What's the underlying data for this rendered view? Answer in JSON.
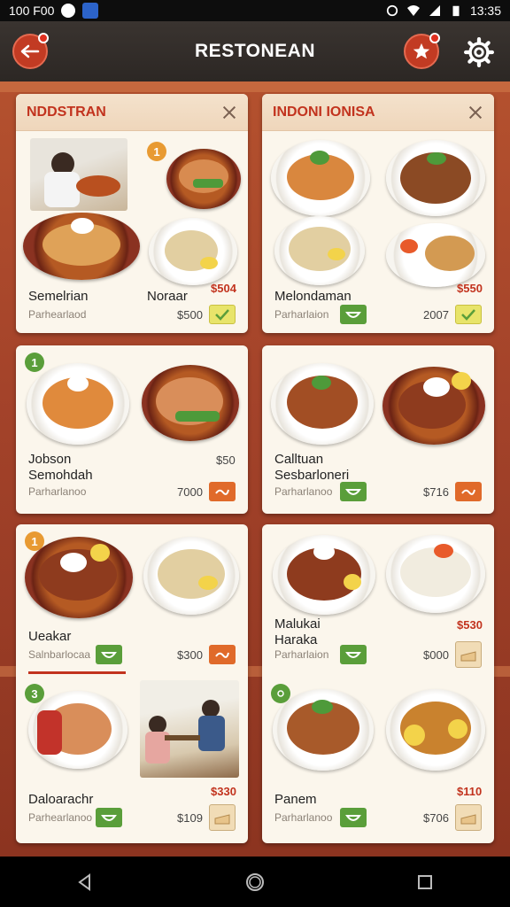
{
  "status_bar": {
    "left_text": "100 F00",
    "time": "13:35"
  },
  "app_bar": {
    "title": "RESTONEAN"
  },
  "cards": [
    {
      "title": "NDDSTRAN",
      "badge_top": "1",
      "items": [
        {
          "name": "Semelrian",
          "subtitle": "Parhearlaod",
          "price": "$500",
          "price_red": "$504"
        },
        {
          "name": "Noraar"
        }
      ]
    },
    {
      "title": "INDONI IONISA",
      "items": [
        {
          "name": "Melondaman",
          "subtitle": "Parharlaion",
          "price": "2007",
          "price_red": "$550"
        }
      ]
    },
    {
      "badge_top": "1",
      "items": [
        {
          "name": "Jobson",
          "name2": "Semohdah",
          "subtitle": "Parharlanoo",
          "price": "7000",
          "price_top": "$50"
        }
      ]
    },
    {
      "items": [
        {
          "name": "Calltuan",
          "name2": "Sesbarloneri",
          "subtitle": "Parharlanoo",
          "price": "$716"
        }
      ]
    },
    {
      "badge_top": "1",
      "badge_mid": "3",
      "items": [
        {
          "name": "Ueakar",
          "subtitle": "Salnbarlocaa",
          "price": "$300"
        },
        {
          "name": "Daloarachr",
          "subtitle": "Parhearlanoo",
          "price": "$109",
          "price_red": "$330"
        }
      ]
    },
    {
      "items": [
        {
          "name": "Malukai",
          "name2": "Haraka",
          "subtitle": "Parharlaion",
          "price": "$000",
          "price_red": "$530"
        },
        {
          "name": "Panem",
          "subtitle": "Parharlanoo",
          "price": "$706",
          "price_red": "$110"
        }
      ]
    }
  ],
  "nav": {
    "back": "back-icon",
    "home": "home-icon",
    "recents": "recents-icon"
  },
  "colors": {
    "accent": "#c2331e",
    "card_bg": "#fbf6ec",
    "header_bg": "#2c2724",
    "green": "#5a9e3a",
    "orange": "#e06a2a"
  }
}
